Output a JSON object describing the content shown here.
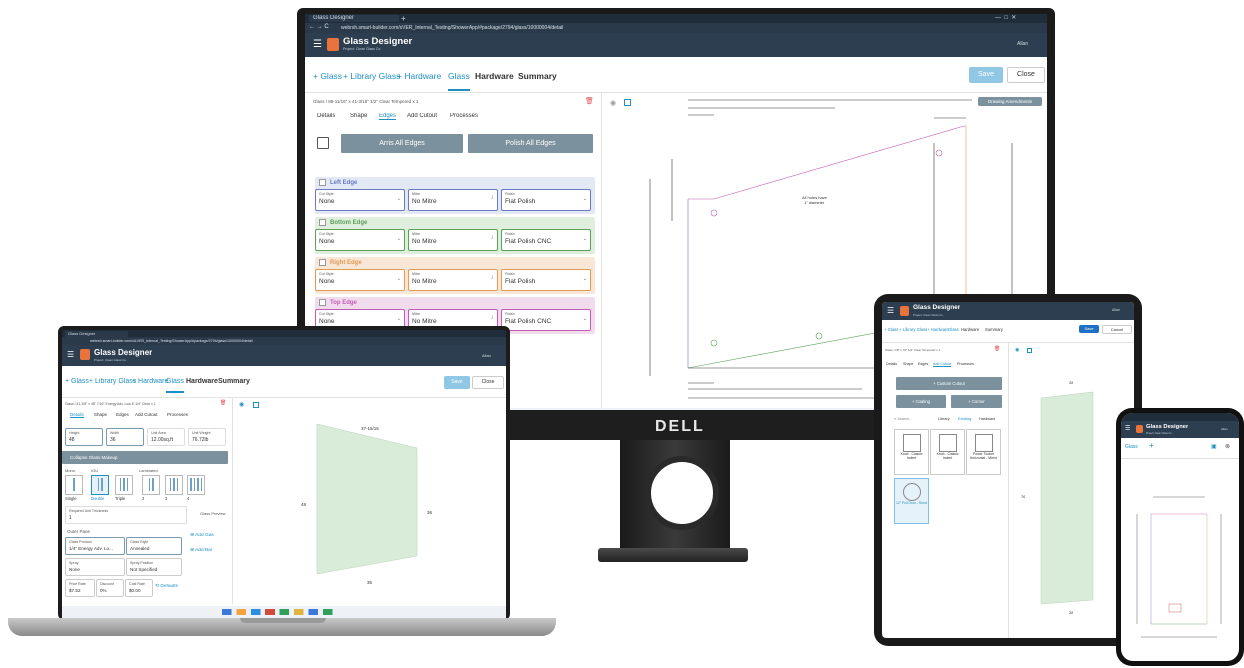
{
  "browser": {
    "tab_title": "Glass Designer",
    "url": "webrsh.smart-builder.com/sVER_Internal_Testing/ShowerApp/#package/2794/glass/10000004/detail",
    "laptop_url": "webrsh.smart-builder.com/sILVER_Internal_Testing/ShowerApp/#package/2794/glass/10000004/detail"
  },
  "app": {
    "title": "Glass Designer",
    "subtitle": "Project: Clean Glass Co.",
    "user": "Allan"
  },
  "nav": {
    "add_glass": "+ Glass",
    "add_library_glass": "+ Library Glass",
    "add_hardware": "+ Hardware",
    "glass": "Glass",
    "hardware": "Hardware",
    "summary": "Summary",
    "save": "Save",
    "close": "Close",
    "cancel": "Cancel"
  },
  "monitor": {
    "breadcrumb": "Glass / 89-11/16\" x 41-3/16\" 1/2\" Clear Tempered x 1",
    "subtabs": [
      "Details",
      "Shape",
      "Edges",
      "Add Cutout",
      "Processes"
    ],
    "arris_all": "Arris All Edges",
    "polish_all": "Polish All Edges",
    "drawing_button": "Drawing Amendments",
    "field_labels": {
      "cut": "Cut Style",
      "mitre": "Mitre",
      "finish": "Finish"
    },
    "edges": [
      {
        "name": "Left Edge",
        "color": "#e3e8f5",
        "border": "#6b79c8",
        "cut": "None",
        "mitre": "No Mitre",
        "finish": "Flat Polish"
      },
      {
        "name": "Bottom Edge",
        "color": "#dfeedd",
        "border": "#5aa05a",
        "cut": "None",
        "mitre": "No Mitre",
        "finish": "Flat Polish CNC"
      },
      {
        "name": "Right Edge",
        "color": "#f8e6d6",
        "border": "#e39a55",
        "cut": "None",
        "mitre": "No Mitre",
        "finish": "Flat Polish"
      },
      {
        "name": "Top Edge",
        "color": "#f1dcee",
        "border": "#c45cb4",
        "cut": "None",
        "mitre": "No Mitre",
        "finish": "Flat Polish CNC"
      }
    ],
    "drawing_note": "All holes have 1\" diameter"
  },
  "laptop": {
    "breadcrumb": "Glass / 41-3/8\" x 48\" 7/16\" Energy Adv. Low-E 1/4\" Clear x 1",
    "subtabs": [
      "Details",
      "Shape",
      "Edges",
      "Add Cutout",
      "Processes"
    ],
    "height_label": "Height",
    "height": "48",
    "width_label": "Width",
    "width": "36",
    "area_label": "Unit Area",
    "area": "12.00sq.ft",
    "weight_label": "Unit Weight",
    "weight": "76.72lb",
    "makeup_header": "Collapse Glass Makeup",
    "mono": "Mono",
    "igu": "IGU",
    "laminated": "Laminated",
    "makeup_options": [
      "Single",
      "Double",
      "Triple",
      "2",
      "3",
      "4"
    ],
    "preview_label": "Glass Preview",
    "thickness_label": "Required Unit Thickness",
    "thickness": "1",
    "outer_pane": "Outer Pane",
    "glass_product_label": "Glass Product",
    "glass_product": "1/4\" Energy Adv. Lo...",
    "glass_style_label": "Glass Style",
    "glass_style": "Annealed",
    "spray_label": "Spray",
    "spray": "None",
    "spray_position_label": "Spray Position",
    "spray_position": "Not Specified",
    "price_rate_label": "Price Rate",
    "price_rate": "$7.52",
    "discount_label": "Discount",
    "discount": "0%",
    "cost_label": "Cost Rate",
    "cost_rate": "$0.00",
    "defaults": "Defaults",
    "add_gas": "Add Gas",
    "add_bar": "Add Bar",
    "dim_top": "37-15/16",
    "dim_left": "48",
    "dim_right": "36",
    "dim_bottom": "36"
  },
  "tablet": {
    "breadcrumb": "Glass / 28\" x 76\" 1/2\" Clear Tempered x 1",
    "subtabs": [
      "Details",
      "Shape",
      "Edges",
      "Add Cutout",
      "Processes"
    ],
    "custom_cutout": "+ Custom Cutout",
    "coating": "+ Coating",
    "corner": "+ Corner",
    "search": "Search...",
    "library": "Library",
    "existing": "Existing",
    "hardware": "Hardware",
    "items": [
      "Knob - Classic Indent",
      "Knob - Classic Indent",
      "Power Socket Horizontal - Mirror",
      "12\" Pull Door - Short"
    ],
    "dim_top": "28",
    "dim_left": "76",
    "dim_bottom": "28"
  },
  "phone": {
    "glass_tab": "Glass",
    "user": "Allan"
  }
}
